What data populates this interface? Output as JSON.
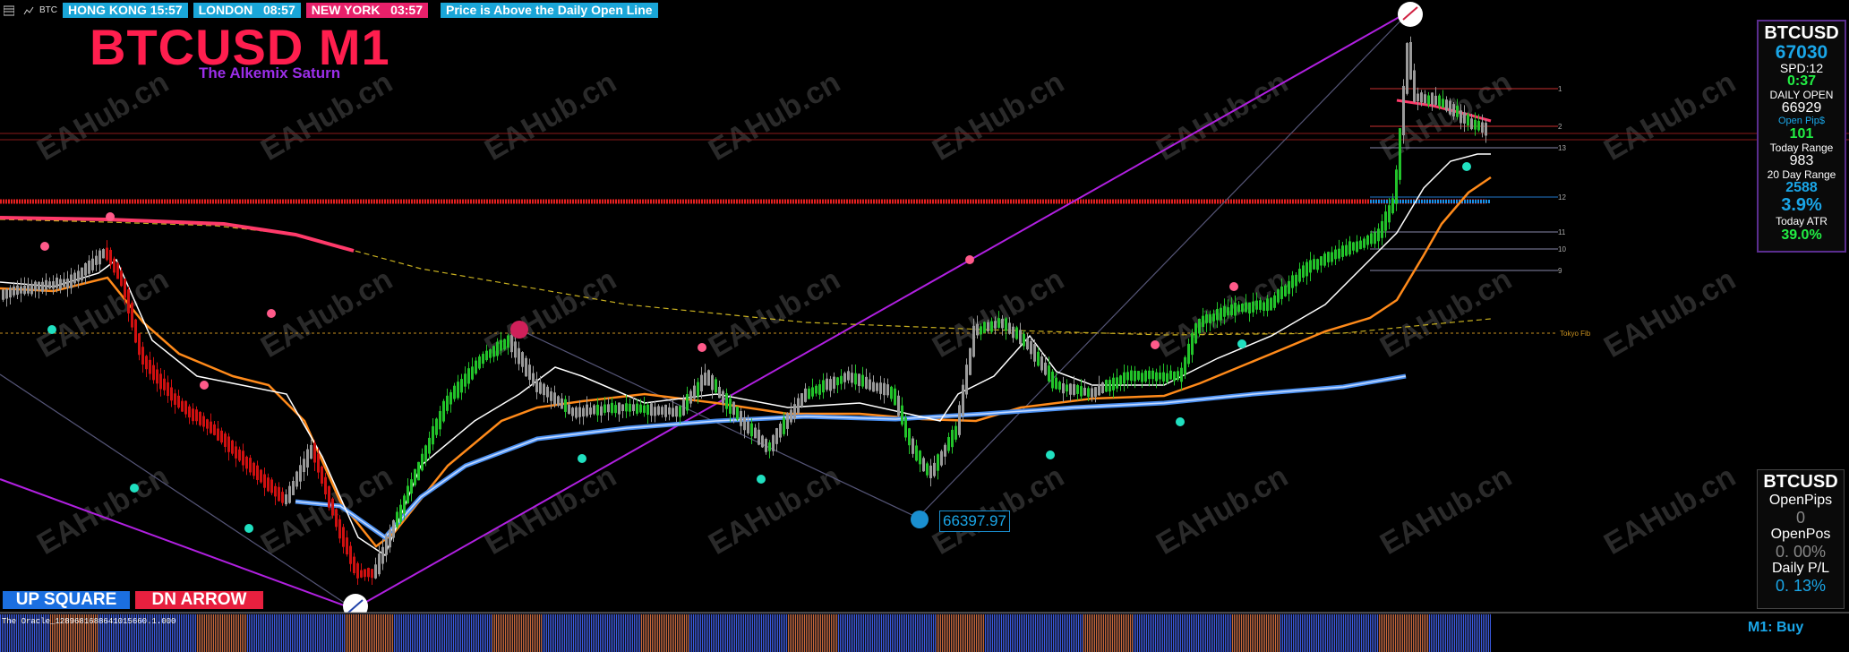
{
  "top_bar": {
    "symbol_short": "BTC",
    "clocks": [
      {
        "city": "HONG KONG",
        "time": "15:57"
      },
      {
        "city": "LONDON",
        "time": "08:57"
      },
      {
        "city": "NEW YORK",
        "time": "03:57"
      }
    ],
    "alert": "Price is Above the Daily Open Line"
  },
  "title": "BTCUSD M1",
  "subtitle": "The Alkemix Saturn",
  "watermark": "EAHub.cn",
  "price_label": "66397.97",
  "level_labels": [
    "1",
    "2",
    "13",
    "12",
    "11",
    "10",
    "9",
    "Tokyo Fib"
  ],
  "buttons": {
    "up": "UP SQUARE",
    "dn": "DN ARROW"
  },
  "oracle_label": "The Oracle_1289681688641015660.1.000",
  "signal": "M1: Buy",
  "info_panel": {
    "symbol": "BTCUSD",
    "price": "67030",
    "spd": "SPD:12",
    "timer": "0:37",
    "daily_open_label": "DAILY OPEN",
    "daily_open": "66929",
    "open_pips_label": "Open Pip$",
    "open_pips": "101",
    "today_range_label": "Today Range",
    "today_range": "983",
    "day20_label": "20 Day Range",
    "day20": "2588",
    "pct": "3.9%",
    "atr_label": "Today ATR",
    "atr": "39.0%"
  },
  "account_panel": {
    "symbol": "BTCUSD",
    "open_pips_label": "OpenPips",
    "open_pips": "0",
    "open_pos_label": "OpenPos",
    "open_pos": "0. 00%",
    "daily_pl_label": "Daily P/L",
    "daily_pl": "0. 13%"
  },
  "colors": {
    "up": "#22c32a",
    "down": "#d01010",
    "neutral": "#9a9a9a",
    "accent_blue": "#1aa6e8",
    "accent_red": "#ff1e4e"
  }
}
